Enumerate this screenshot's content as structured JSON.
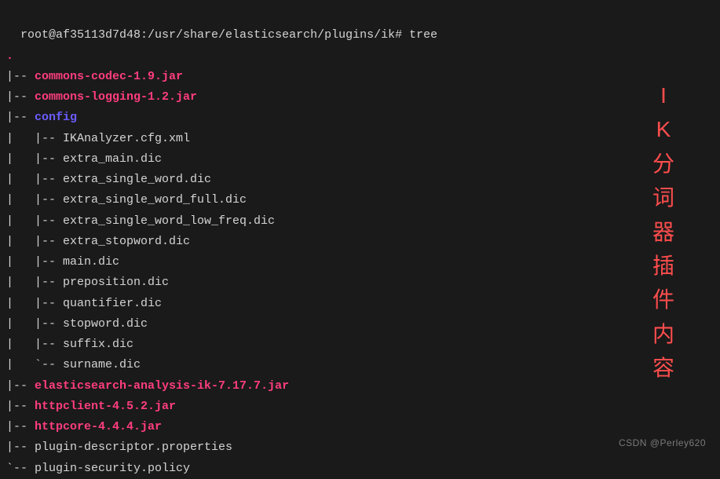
{
  "terminal": {
    "prompt": "root@af35113d7d48:/usr/share/elasticsearch/plugins/ik# ",
    "command": "tree",
    "root_dot": ".",
    "lines": [
      {
        "prefix": "|-- ",
        "name": "commons-codec-1.9.jar",
        "type": "jar"
      },
      {
        "prefix": "|-- ",
        "name": "commons-logging-1.2.jar",
        "type": "jar"
      },
      {
        "prefix": "|-- ",
        "name": "config",
        "type": "dir"
      },
      {
        "prefix": "|   |-- ",
        "name": "IKAnalyzer.cfg.xml",
        "type": "file"
      },
      {
        "prefix": "|   |-- ",
        "name": "extra_main.dic",
        "type": "file"
      },
      {
        "prefix": "|   |-- ",
        "name": "extra_single_word.dic",
        "type": "file"
      },
      {
        "prefix": "|   |-- ",
        "name": "extra_single_word_full.dic",
        "type": "file"
      },
      {
        "prefix": "|   |-- ",
        "name": "extra_single_word_low_freq.dic",
        "type": "file"
      },
      {
        "prefix": "|   |-- ",
        "name": "extra_stopword.dic",
        "type": "file"
      },
      {
        "prefix": "|   |-- ",
        "name": "main.dic",
        "type": "file"
      },
      {
        "prefix": "|   |-- ",
        "name": "preposition.dic",
        "type": "file"
      },
      {
        "prefix": "|   |-- ",
        "name": "quantifier.dic",
        "type": "file"
      },
      {
        "prefix": "|   |-- ",
        "name": "stopword.dic",
        "type": "file"
      },
      {
        "prefix": "|   |-- ",
        "name": "suffix.dic",
        "type": "file"
      },
      {
        "prefix": "|   `-- ",
        "name": "surname.dic",
        "type": "file"
      },
      {
        "prefix": "|-- ",
        "name": "elasticsearch-analysis-ik-7.17.7.jar",
        "type": "jar"
      },
      {
        "prefix": "|-- ",
        "name": "httpclient-4.5.2.jar",
        "type": "jar"
      },
      {
        "prefix": "|-- ",
        "name": "httpcore-4.4.4.jar",
        "type": "jar"
      },
      {
        "prefix": "|-- ",
        "name": "plugin-descriptor.properties",
        "type": "file"
      },
      {
        "prefix": "`-- ",
        "name": "plugin-security.policy",
        "type": "file"
      }
    ]
  },
  "side_label": {
    "chars": [
      "I",
      "K",
      "分",
      "词",
      "器",
      "插",
      "件",
      "内",
      "容"
    ]
  },
  "watermark": "CSDN @Perley620"
}
